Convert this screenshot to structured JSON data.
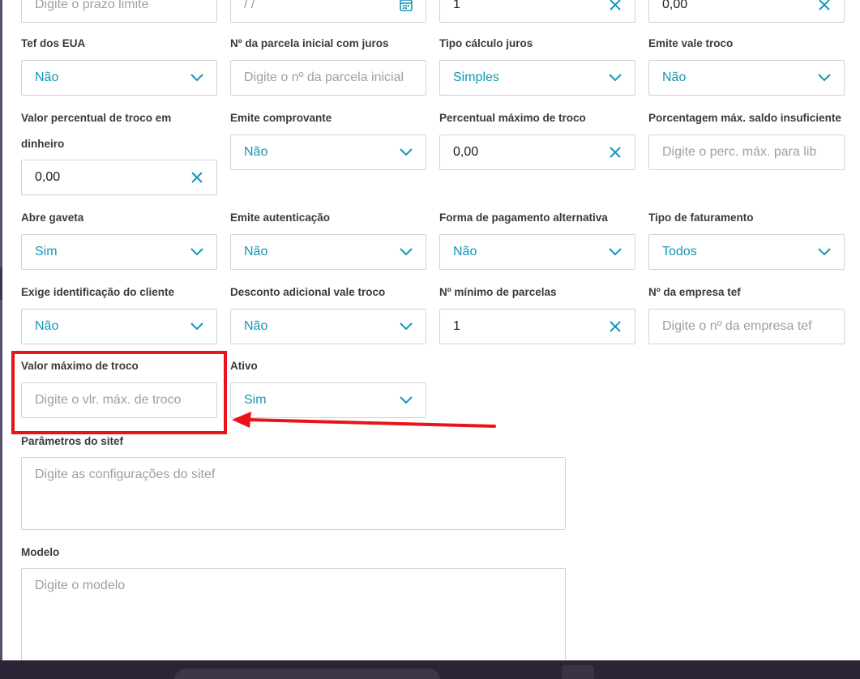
{
  "top_row": {
    "field1_placeholder": "Digite o prazo limite",
    "field2_placeholder": "/ /",
    "field3_value": "1",
    "field4_value": "0,00"
  },
  "fields": {
    "tef_eua": {
      "label": "Tef dos EUA",
      "value": "Não"
    },
    "parcela_inicial": {
      "label": "Nº da parcela inicial com juros",
      "placeholder": "Digite o nº da parcela inicial"
    },
    "tipo_calculo": {
      "label": "Tipo cálculo juros",
      "value": "Simples"
    },
    "emite_vale": {
      "label": "Emite vale troco",
      "value": "Não"
    },
    "valor_percentual": {
      "label_line1": "Valor percentual de troco em",
      "label_line2": "dinheiro",
      "value": "0,00"
    },
    "emite_comprovante": {
      "label": "Emite comprovante",
      "value": "Não"
    },
    "percentual_max": {
      "label": "Percentual máximo de troco",
      "value": "0,00"
    },
    "porcentagem_max": {
      "label": "Porcentagem máx. saldo insuficiente",
      "placeholder": "Digite o perc. máx. para lib"
    },
    "abre_gaveta": {
      "label": "Abre gaveta",
      "value": "Sim"
    },
    "emite_autenticacao": {
      "label": "Emite autenticação",
      "value": "Não"
    },
    "forma_pagamento": {
      "label": "Forma de pagamento alternativa",
      "value": "Não"
    },
    "tipo_faturamento": {
      "label": "Tipo de faturamento",
      "value": "Todos"
    },
    "exige_identificacao": {
      "label": "Exige identificação do cliente",
      "value": "Não"
    },
    "desconto_adicional": {
      "label": "Desconto adicional vale troco",
      "value": "Não"
    },
    "minimo_parcelas": {
      "label": "Nº mínimo de parcelas",
      "value": "1"
    },
    "empresa_tef": {
      "label": "Nº da empresa tef",
      "placeholder": "Digite o nº da empresa tef"
    },
    "valor_maximo": {
      "label": "Valor máximo de troco",
      "placeholder": "Digite o vlr. máx. de troco"
    },
    "ativo": {
      "label": "Ativo",
      "value": "Sim"
    },
    "parametros_sitef": {
      "label": "Parâmetros do sitef",
      "placeholder": "Digite as configurações do sitef"
    },
    "modelo": {
      "label": "Modelo",
      "placeholder": "Digite o modelo"
    }
  },
  "colors": {
    "select_value": "#1496b5",
    "icon": "#1496b5",
    "highlight": "#e8141a"
  }
}
